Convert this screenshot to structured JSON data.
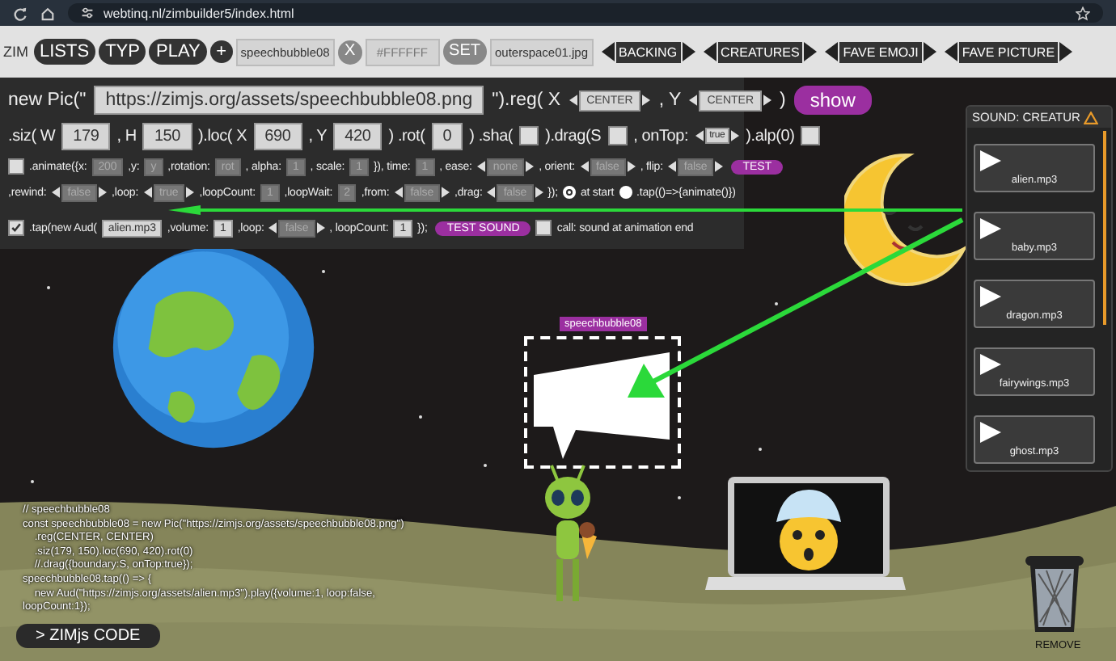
{
  "browser": {
    "url": "webtinq.nl/zimbuilder5/index.html"
  },
  "toolbar": {
    "brand": "ZIM",
    "buttons": [
      {
        "label": "LISTS"
      },
      {
        "label": "TYP"
      },
      {
        "label": "PLAY"
      },
      {
        "label": "+"
      }
    ],
    "name_field": {
      "value": "speechbubble08"
    },
    "clear_button": "X",
    "color_field": {
      "placeholder": "#FFFFFF"
    },
    "set_button": "SET",
    "backing_field": {
      "value": "outerspace01.jpg"
    },
    "selectors": [
      {
        "label": "BACKING"
      },
      {
        "label": "CREATURES"
      },
      {
        "label": "FAVE EMOJI"
      },
      {
        "label": "FAVE PICTURE"
      }
    ]
  },
  "panel": {
    "rows": [
      {
        "items": [
          {
            "kind": "text",
            "text": "new Pic(\""
          },
          {
            "kind": "field",
            "value": "https://zimjs.org/assets/speechbubble08.png",
            "disabled": false
          },
          {
            "kind": "text",
            "text": "\").reg( X"
          },
          {
            "kind": "select",
            "value": "CENTER",
            "disabled": false
          },
          {
            "kind": "text",
            "text": ", Y"
          },
          {
            "kind": "select",
            "value": "CENTER",
            "disabled": false
          },
          {
            "kind": "text",
            "text": ")"
          },
          {
            "kind": "button",
            "label": "show"
          }
        ]
      },
      {
        "items": [
          {
            "kind": "text",
            "text": ".siz( W"
          },
          {
            "kind": "field",
            "value": "179",
            "disabled": false
          },
          {
            "kind": "text",
            "text": ", H"
          },
          {
            "kind": "field",
            "value": "150",
            "disabled": false
          },
          {
            "kind": "text",
            "text": ").loc( X"
          },
          {
            "kind": "field",
            "value": "690",
            "disabled": false
          },
          {
            "kind": "text",
            "text": ", Y"
          },
          {
            "kind": "field",
            "value": "420",
            "disabled": false
          },
          {
            "kind": "text",
            "text": ") .rot("
          },
          {
            "kind": "field",
            "value": "0",
            "disabled": false
          },
          {
            "kind": "text",
            "text": ") .sha("
          },
          {
            "kind": "check",
            "checked": false
          },
          {
            "kind": "text",
            "text": ").drag(S"
          },
          {
            "kind": "check",
            "checked": false
          },
          {
            "kind": "text",
            "text": ", onTop:"
          },
          {
            "kind": "select",
            "value": "true",
            "disabled": false
          },
          {
            "kind": "text",
            "text": ").alp(0)"
          },
          {
            "kind": "check",
            "checked": false
          }
        ]
      },
      {
        "items": [
          {
            "kind": "check",
            "checked": false
          },
          {
            "kind": "text",
            "text": ".animate({x:"
          },
          {
            "kind": "field",
            "value": "200",
            "disabled": true
          },
          {
            "kind": "text",
            "text": ",y:"
          },
          {
            "kind": "field",
            "value": "y",
            "disabled": true
          },
          {
            "kind": "text",
            "text": ",rotation:"
          },
          {
            "kind": "field",
            "value": "rot",
            "disabled": true
          },
          {
            "kind": "text",
            "text": ", alpha:"
          },
          {
            "kind": "field",
            "value": "1",
            "disabled": true
          },
          {
            "kind": "text",
            "text": ", scale:"
          },
          {
            "kind": "field",
            "value": "1",
            "disabled": true
          },
          {
            "kind": "text",
            "text": "}), time:"
          },
          {
            "kind": "field",
            "value": "1",
            "disabled": true
          },
          {
            "kind": "text",
            "text": ", ease:"
          },
          {
            "kind": "select",
            "value": "none",
            "disabled": true
          },
          {
            "kind": "text",
            "text": ", orient:"
          },
          {
            "kind": "select",
            "value": "false",
            "disabled": true
          },
          {
            "kind": "text",
            "text": ", flip:"
          },
          {
            "kind": "select",
            "value": "false",
            "disabled": true
          },
          {
            "kind": "button",
            "label": "TEST"
          }
        ]
      },
      {
        "items": [
          {
            "kind": "text",
            "text": ",rewind:"
          },
          {
            "kind": "select",
            "value": "false",
            "disabled": true
          },
          {
            "kind": "text",
            "text": ",loop:"
          },
          {
            "kind": "select",
            "value": "true",
            "disabled": true
          },
          {
            "kind": "text",
            "text": ",loopCount:"
          },
          {
            "kind": "field",
            "value": "1",
            "disabled": true
          },
          {
            "kind": "text",
            "text": ",loopWait:"
          },
          {
            "kind": "field",
            "value": "2",
            "disabled": true
          },
          {
            "kind": "text",
            "text": ",from:"
          },
          {
            "kind": "select",
            "value": "false",
            "disabled": true
          },
          {
            "kind": "text",
            "text": ",drag:"
          },
          {
            "kind": "select",
            "value": "false",
            "disabled": true
          },
          {
            "kind": "text",
            "text": "});"
          },
          {
            "kind": "radio",
            "selected": true
          },
          {
            "kind": "text",
            "text": "at start"
          },
          {
            "kind": "radio",
            "selected": false
          },
          {
            "kind": "text",
            "text": ".tap(()=>{animate()})"
          }
        ]
      },
      {
        "items": [
          {
            "kind": "check",
            "checked": true
          },
          {
            "kind": "text",
            "text": ".tap(new Aud("
          },
          {
            "kind": "field",
            "value": "alien.mp3",
            "disabled": false
          },
          {
            "kind": "text",
            "text": ",volume:"
          },
          {
            "kind": "field",
            "value": "1",
            "disabled": false
          },
          {
            "kind": "text",
            "text": ",loop:"
          },
          {
            "kind": "select",
            "value": "false",
            "disabled": true
          },
          {
            "kind": "text",
            "text": ", loopCount:"
          },
          {
            "kind": "field",
            "value": "1",
            "disabled": false
          },
          {
            "kind": "text",
            "text": "});"
          },
          {
            "kind": "button",
            "label": "TEST SOUND"
          },
          {
            "kind": "check",
            "checked": false
          },
          {
            "kind": "text",
            "text": "call: sound at animation end"
          }
        ]
      }
    ]
  },
  "sound_panel": {
    "title": "SOUND: CREATUR",
    "items": [
      {
        "label": "alien.mp3"
      },
      {
        "label": "baby.mp3"
      },
      {
        "label": "dragon.mp3"
      },
      {
        "label": "fairywings.mp3"
      },
      {
        "label": "ghost.mp3"
      }
    ]
  },
  "stage": {
    "selection_label": "speechbubble08",
    "code_lines": [
      "// speechbubble08",
      "const speechbubble08 = new Pic(\"https://zimjs.org/assets/speechbubble08.png\")",
      "    .reg(CENTER, CENTER)",
      "    .siz(179, 150).loc(690, 420).rot(0)",
      "    //.drag({boundary:S, onTop:true});",
      "speechbubble08.tap(() => {",
      "    new Aud(\"https://zimjs.org/assets/alien.mp3\").play({volume:1, loop:false,",
      "loopCount:1});"
    ],
    "code_button": "> ZIMjs CODE",
    "remove_label": "REMOVE"
  }
}
